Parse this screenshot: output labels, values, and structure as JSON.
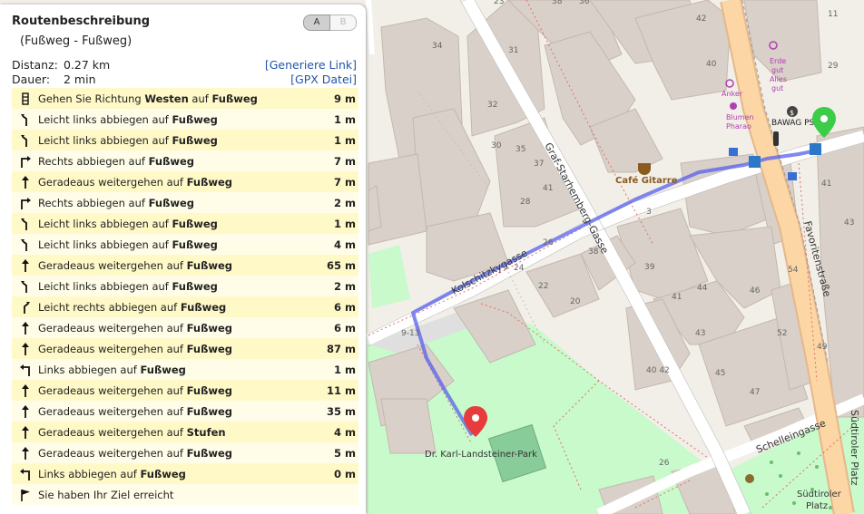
{
  "panel": {
    "title": "Routenbeschreibung",
    "subtitle": "(Fußweg - Fußweg)",
    "buttons": {
      "a": "A",
      "b": "B"
    },
    "distance_label": "Distanz:",
    "distance_value": "0.27 km",
    "duration_label": "Dauer:",
    "duration_value": "2 min",
    "generate_link": "[Generiere Link]",
    "gpx_link": "[GPX Datei]"
  },
  "steps": [
    {
      "icon": "compass",
      "pre": "Gehen Sie Richtung ",
      "bold": "Westen",
      "mid": " auf ",
      "road": "Fußweg",
      "dist": "9 m"
    },
    {
      "icon": "slight-left",
      "pre": "Leicht links abbiegen auf ",
      "road": "Fußweg",
      "dist": "1 m"
    },
    {
      "icon": "slight-left",
      "pre": "Leicht links abbiegen auf ",
      "road": "Fußweg",
      "dist": "1 m"
    },
    {
      "icon": "right",
      "pre": "Rechts abbiegen auf ",
      "road": "Fußweg",
      "dist": "7 m"
    },
    {
      "icon": "straight",
      "pre": "Geradeaus weitergehen auf ",
      "road": "Fußweg",
      "dist": "7 m"
    },
    {
      "icon": "right",
      "pre": "Rechts abbiegen auf ",
      "road": "Fußweg",
      "dist": "2 m"
    },
    {
      "icon": "slight-left",
      "pre": "Leicht links abbiegen auf ",
      "road": "Fußweg",
      "dist": "1 m"
    },
    {
      "icon": "slight-left",
      "pre": "Leicht links abbiegen auf ",
      "road": "Fußweg",
      "dist": "4 m"
    },
    {
      "icon": "straight",
      "pre": "Geradeaus weitergehen auf ",
      "road": "Fußweg",
      "dist": "65 m"
    },
    {
      "icon": "slight-left",
      "pre": "Leicht links abbiegen auf ",
      "road": "Fußweg",
      "dist": "2 m"
    },
    {
      "icon": "slight-right",
      "pre": "Leicht rechts abbiegen auf ",
      "road": "Fußweg",
      "dist": "6 m"
    },
    {
      "icon": "straight",
      "pre": "Geradeaus weitergehen auf ",
      "road": "Fußweg",
      "dist": "6 m"
    },
    {
      "icon": "straight",
      "pre": "Geradeaus weitergehen auf ",
      "road": "Fußweg",
      "dist": "87 m"
    },
    {
      "icon": "left",
      "pre": "Links abbiegen auf ",
      "road": "Fußweg",
      "dist": "1 m"
    },
    {
      "icon": "straight",
      "pre": "Geradeaus weitergehen auf ",
      "road": "Fußweg",
      "dist": "11 m"
    },
    {
      "icon": "straight",
      "pre": "Geradeaus weitergehen auf ",
      "road": "Fußweg",
      "dist": "35 m"
    },
    {
      "icon": "straight",
      "pre": "Geradeaus weitergehen auf ",
      "road": "Stufen",
      "dist": "4 m"
    },
    {
      "icon": "straight",
      "pre": "Geradeaus weitergehen auf ",
      "road": "Fußweg",
      "dist": "5 m"
    },
    {
      "icon": "left",
      "pre": "Links abbiegen auf ",
      "road": "Fußweg",
      "dist": "0 m"
    },
    {
      "icon": "flag",
      "pre": "Sie haben Ihr Ziel erreicht",
      "road": "",
      "dist": ""
    }
  ],
  "map": {
    "streets": {
      "graf": "Graf-Starhemberg-Gasse",
      "kolschitzky": "Kolschitzkygasse",
      "favoriten": "Favoritenstraße",
      "schelleingasse": "Schelleingasse",
      "suedtiroler_vertical": "Südtiroler Platz"
    },
    "places": {
      "park": "Dr. Karl-Landsteiner-Park",
      "cafe": "Café Gitarre",
      "bawag": "BAWAG PSK",
      "erde1": "Erde",
      "erde2": "gut",
      "erde3": "Alles",
      "erde4": "gut",
      "anker": "Anker",
      "blumen1": "Blumen",
      "blumen2": "Pharao",
      "suedtiroler1": "Südtiroler",
      "suedtiroler2": "Platz"
    },
    "house_numbers": {
      "n23": "23",
      "n31": "31",
      "n34": "34",
      "n32": "32",
      "n30": "30",
      "n28": "28",
      "n38": "38",
      "n36": "36",
      "n26": "26",
      "n24": "24",
      "n22": "22",
      "n20": "20",
      "n20b": "20",
      "n35": "35",
      "n37": "37",
      "n42": "42",
      "n40": "40",
      "n41": "41",
      "n3": "3",
      "n38b": "38",
      "n39": "39",
      "n41b": "41",
      "n43": "43",
      "n4042": "40 42",
      "n45": "45",
      "n47": "47",
      "n52": "52",
      "n49": "49",
      "n913": "9-13",
      "n2648": "26 48",
      "n44": "44",
      "n46": "46",
      "n54": "54",
      "n41c": "41",
      "n43b": "43",
      "n29": "29",
      "n11": "11"
    },
    "colors": {
      "route": "#5560ee",
      "start_marker": "#3ccc47",
      "end_marker": "#e83c3c",
      "building": "#d9d0c9",
      "park": "#c8facc",
      "major_road": "#fcd6a4"
    }
  }
}
